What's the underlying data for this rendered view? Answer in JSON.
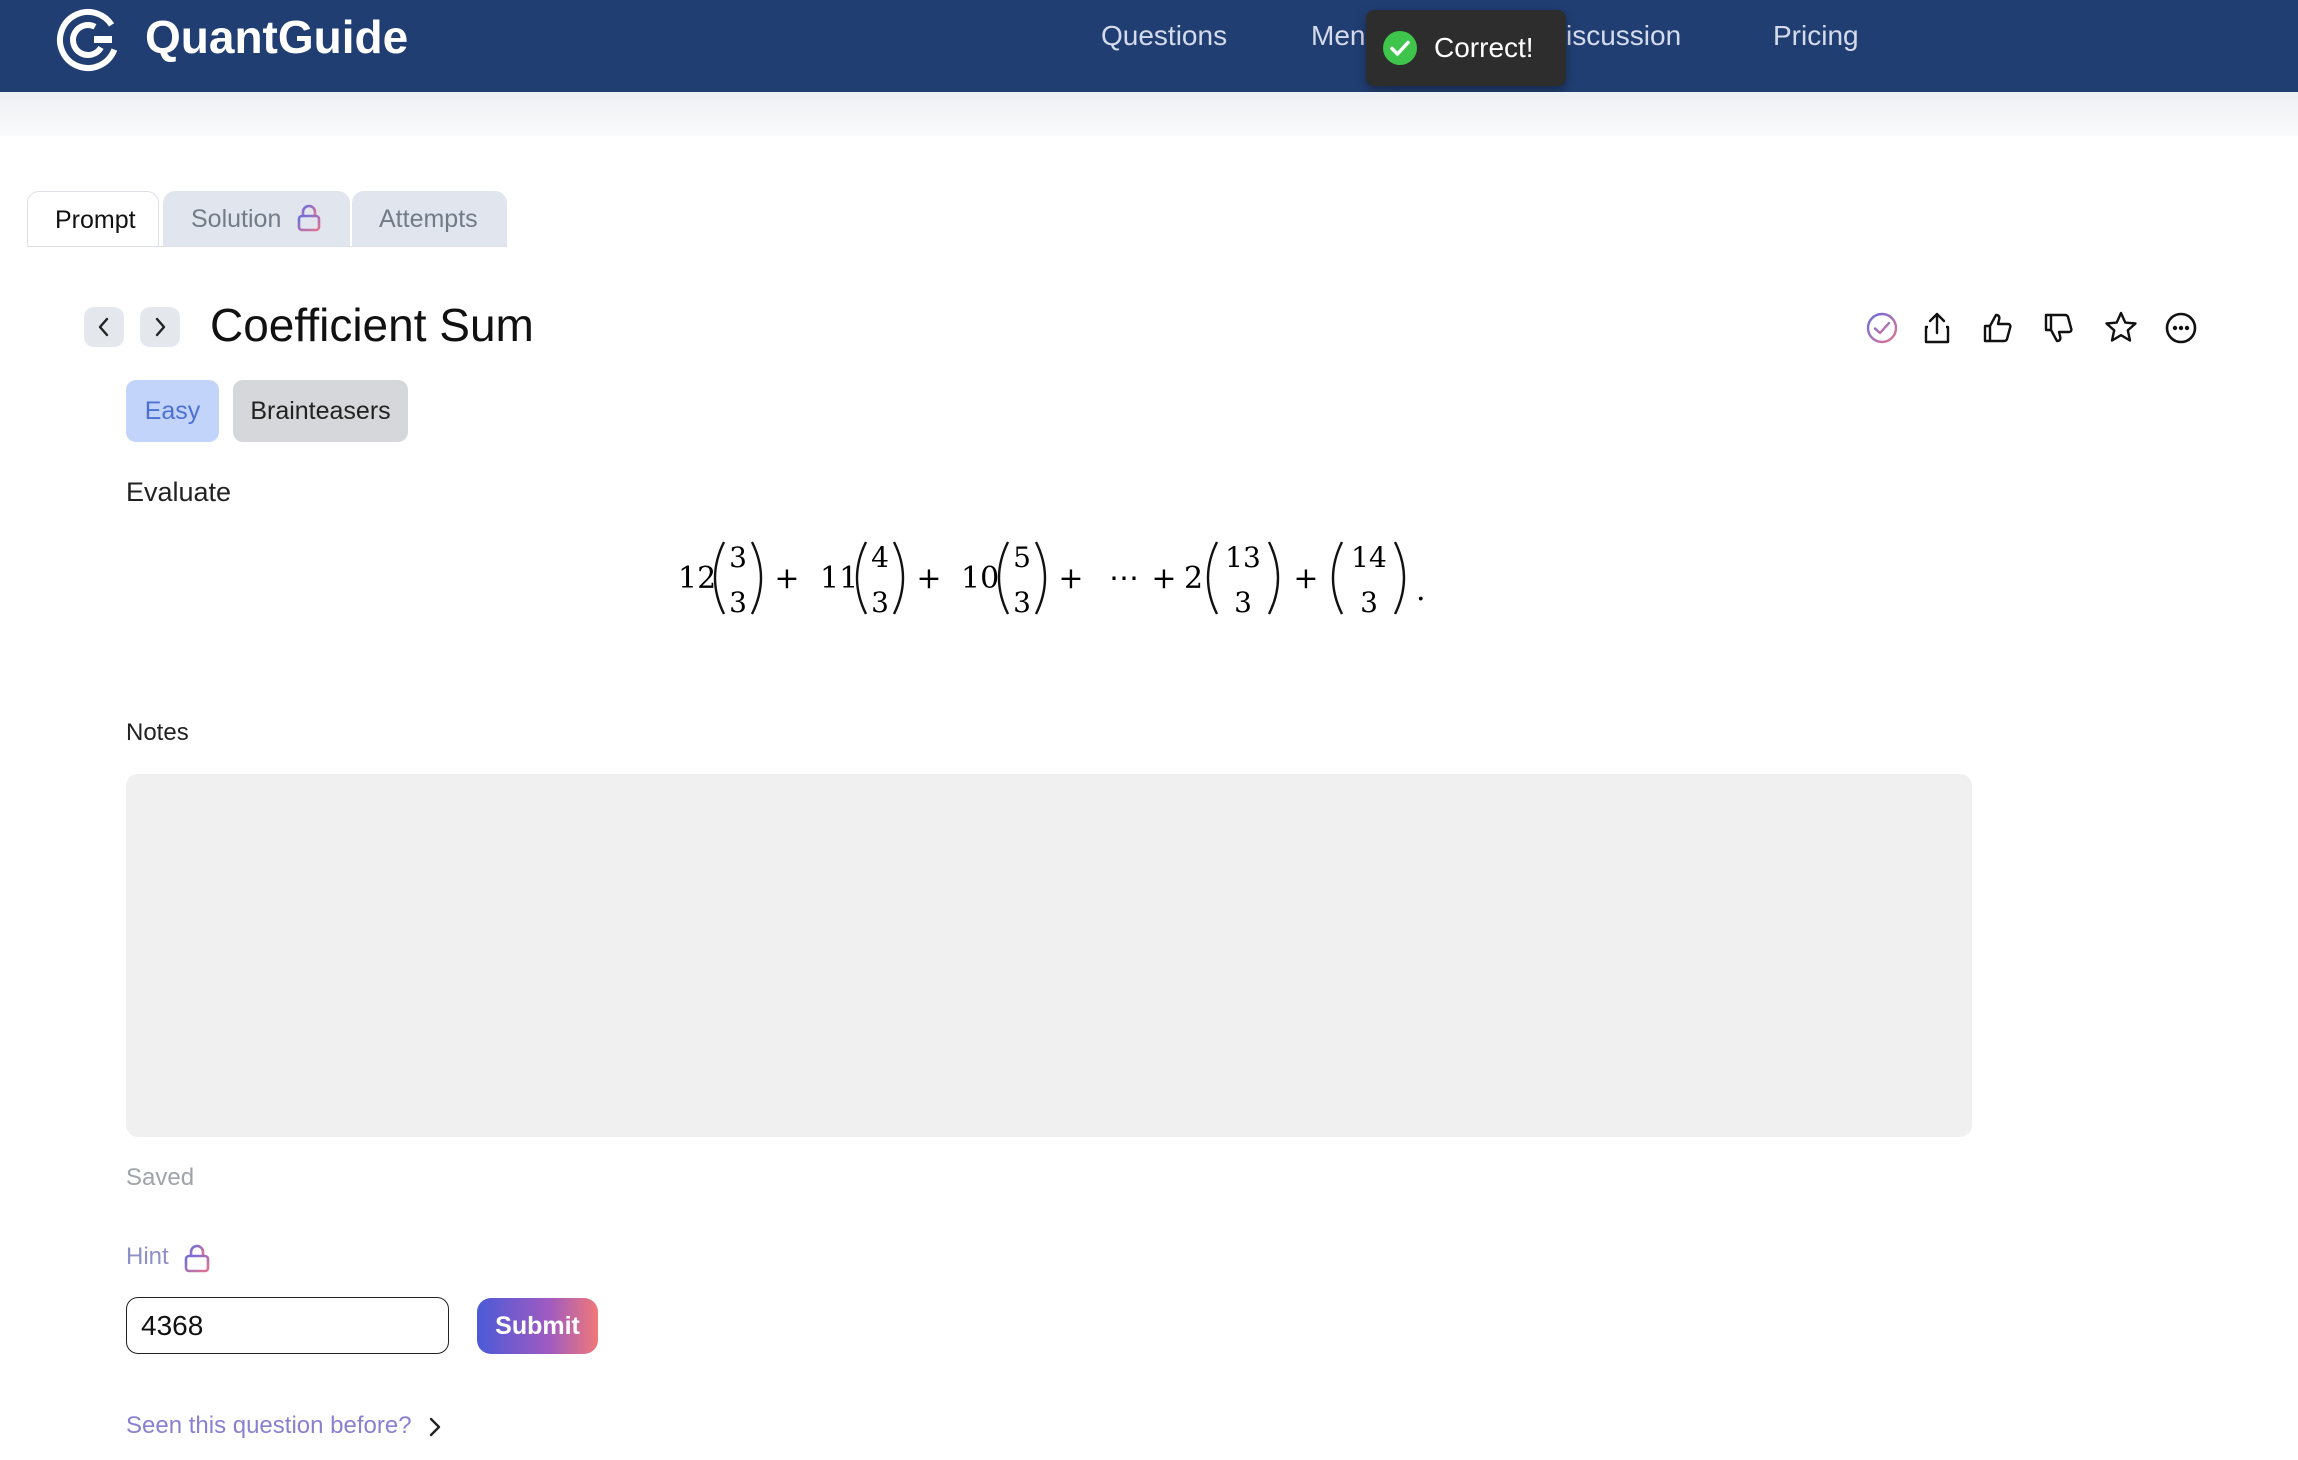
{
  "header": {
    "brand": "QuantGuide",
    "nav": [
      "Questions",
      "Men",
      "iscussion",
      "Pricing"
    ],
    "toast": {
      "text": "Correct!",
      "status_color": "#3fc54b"
    }
  },
  "tabs": [
    {
      "label": "Prompt",
      "active": true
    },
    {
      "label": "Solution",
      "locked": true
    },
    {
      "label": "Attempts"
    }
  ],
  "question": {
    "title": "Coefficient Sum",
    "difficulty": "Easy",
    "category": "Brainteasers",
    "prompt_text": "Evaluate",
    "formula": {
      "coefficients": [
        "12",
        "11",
        "10",
        "2",
        ""
      ],
      "binomial_tops": [
        "3",
        "4",
        "5",
        "13",
        "14"
      ],
      "binomial_bottom": "3",
      "ellipsis": "⋯",
      "end": "."
    },
    "actions": [
      "check-icon",
      "share-icon",
      "thumbs-up-icon",
      "thumbs-down-icon",
      "star-icon",
      "more-icon"
    ]
  },
  "notes": {
    "label": "Notes",
    "value": "",
    "status": "Saved"
  },
  "hint": {
    "label": "Hint",
    "locked": true
  },
  "answer": {
    "value": "4368",
    "submit_label": "Submit"
  },
  "seen_before": "Seen this question before?"
}
